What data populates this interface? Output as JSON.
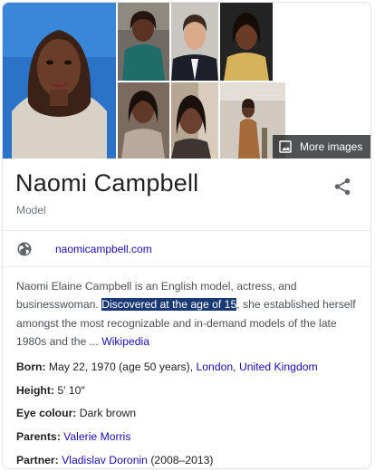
{
  "images": {
    "more_images_label": "More images",
    "items": [
      "portrait-main",
      "photo-2",
      "photo-3",
      "photo-4",
      "photo-5",
      "photo-6",
      "photo-7"
    ]
  },
  "entity": {
    "title": "Naomi Campbell",
    "subtitle": "Model",
    "share_icon": "share-icon"
  },
  "website": {
    "icon": "globe-icon",
    "label": "naomicampbell.com"
  },
  "description": {
    "part1": "Naomi Elaine Campbell is an English model, actress, and businesswoman. ",
    "highlight": "Discovered at the age of 15",
    "part2": ", she established herself amongst the most recognizable and in-demand models of the late 1980s and the ... ",
    "source_link": "Wikipedia"
  },
  "facts": {
    "born": {
      "label": "Born:",
      "value": " May 22, 1970 (age 50 years), ",
      "place1": "London",
      "sep": ", ",
      "place2": "United Kingdom"
    },
    "height": {
      "label": "Height:",
      "value": " 5′ 10″"
    },
    "eye_colour": {
      "label": "Eye colour:",
      "value": " Dark brown"
    },
    "parents": {
      "label": "Parents:",
      "link": "Valerie Morris"
    },
    "partner": {
      "label": "Partner:",
      "link": "Vladislav Doronin",
      "value": " (2008–2013)"
    }
  },
  "colors": {
    "link": "#1a0dab",
    "highlight_bg": "#1a3a75",
    "muted": "#70757a"
  }
}
